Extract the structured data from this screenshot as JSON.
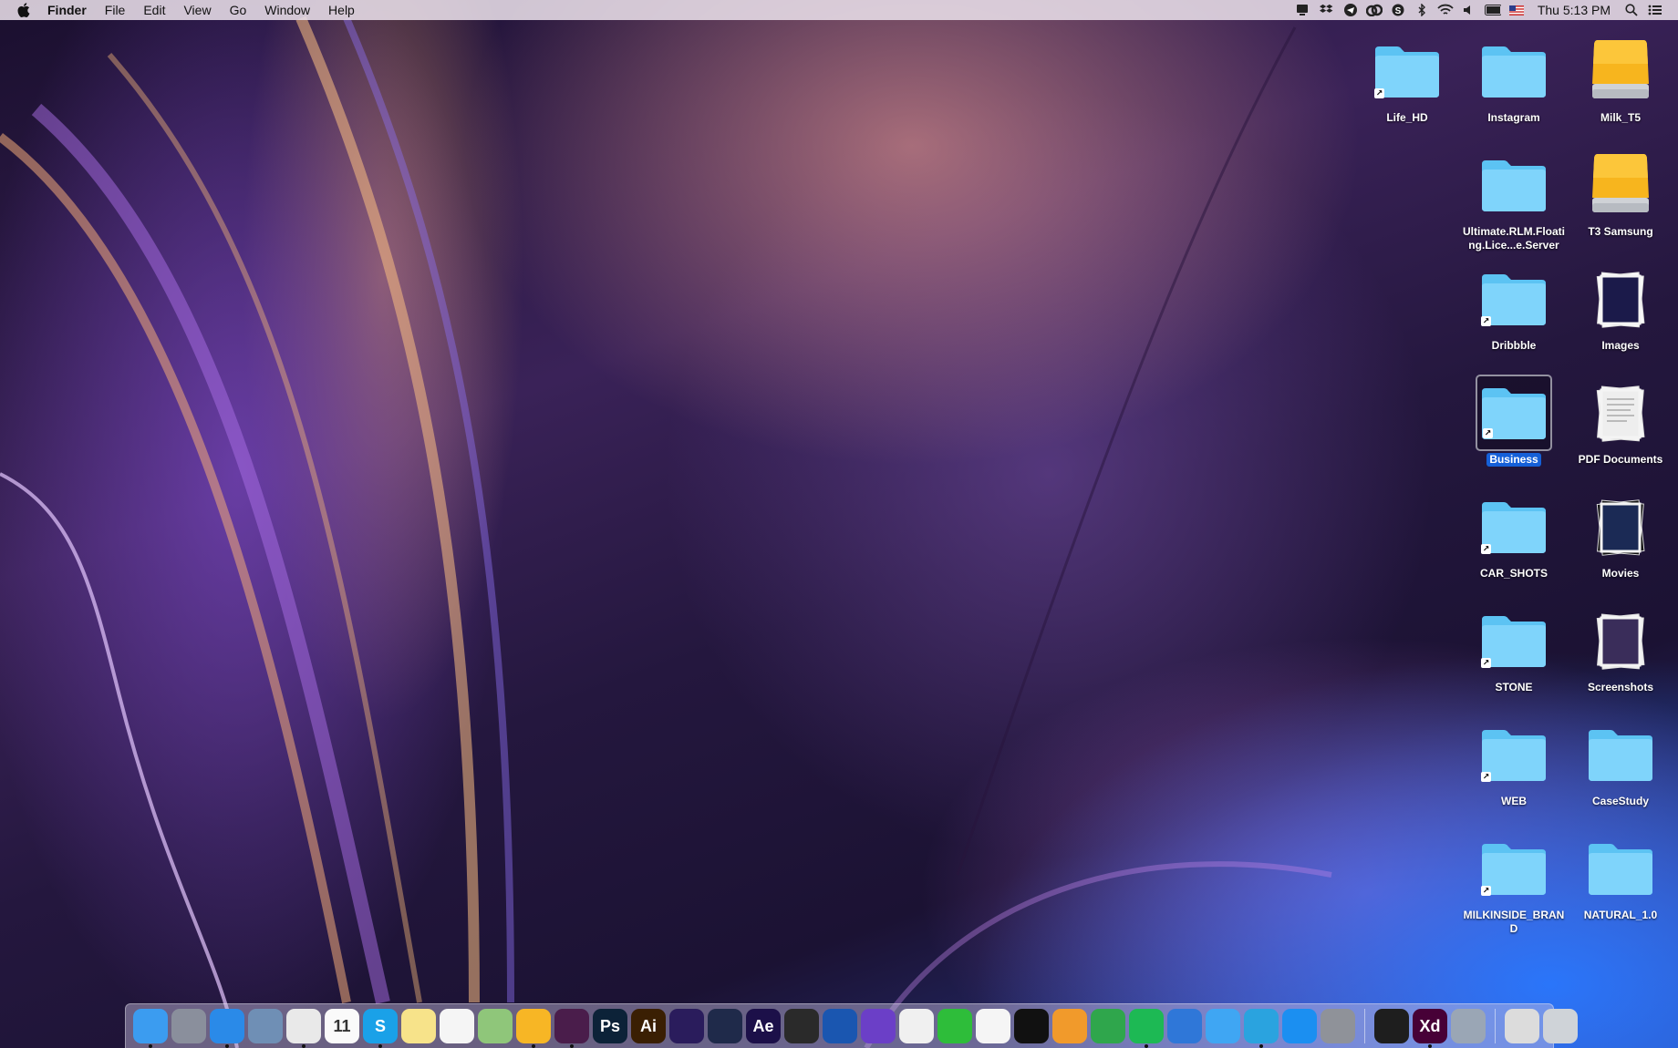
{
  "menubar": {
    "apple_icon": "apple-logo-icon",
    "app_name": "Finder",
    "menus": [
      "File",
      "Edit",
      "View",
      "Go",
      "Window",
      "Help"
    ],
    "status_icons": [
      "notifications-icon",
      "dropbox-icon",
      "telegram-icon",
      "creative-cloud-icon",
      "skype-icon",
      "bluetooth-icon",
      "wifi-icon",
      "volume-icon",
      "battery-icon",
      "us-flag-icon"
    ],
    "clock": "Thu 5:13 PM",
    "right_icons": [
      "spotlight-search-icon",
      "notification-center-icon"
    ]
  },
  "desktop": {
    "items": [
      {
        "label": "Life_HD",
        "kind": "folder",
        "alias": true
      },
      {
        "label": "Instagram",
        "kind": "folder",
        "alias": false
      },
      {
        "label": "Milk_T5",
        "kind": "drive",
        "alias": false
      },
      {
        "label": "Ultimate.RLM.Floating.Lice...e.Server",
        "kind": "folder",
        "alias": false
      },
      {
        "label": "T3 Samsung",
        "kind": "drive",
        "alias": false
      },
      {
        "label": "Dribbble",
        "kind": "folder",
        "alias": true
      },
      {
        "label": "Images",
        "kind": "image-stack",
        "alias": false
      },
      {
        "label": "Business",
        "kind": "folder",
        "alias": true,
        "selected": true
      },
      {
        "label": "PDF Documents",
        "kind": "doc-stack",
        "alias": false
      },
      {
        "label": "CAR_SHOTS",
        "kind": "folder",
        "alias": true
      },
      {
        "label": "Movies",
        "kind": "movie-stack",
        "alias": false
      },
      {
        "label": "STONE",
        "kind": "folder",
        "alias": true
      },
      {
        "label": "Screenshots",
        "kind": "screenshot-stack",
        "alias": false
      },
      {
        "label": "WEB",
        "kind": "folder",
        "alias": true
      },
      {
        "label": "CaseStudy",
        "kind": "folder",
        "alias": false
      },
      {
        "label": "MILKINSIDE_BRAND",
        "kind": "folder",
        "alias": true
      },
      {
        "label": "NATURAL_1.0",
        "kind": "folder",
        "alias": false
      }
    ]
  },
  "dock": {
    "apps": [
      {
        "name": "finder-icon",
        "glyph": "",
        "color": "#3b9cf0",
        "running": true
      },
      {
        "name": "launchpad-icon",
        "glyph": "",
        "color": "#8a8f9c",
        "running": false
      },
      {
        "name": "safari-icon",
        "glyph": "",
        "color": "#2a8ae8",
        "running": true
      },
      {
        "name": "preview-icon",
        "glyph": "",
        "color": "#6f8fb5",
        "running": false
      },
      {
        "name": "chrome-icon",
        "glyph": "",
        "color": "#e9e9e9",
        "running": true
      },
      {
        "name": "calendar-icon",
        "glyph": "11",
        "color": "#fafafa",
        "running": false
      },
      {
        "name": "skype-icon",
        "glyph": "S",
        "color": "#1aa1e8",
        "running": true
      },
      {
        "name": "notes-icon",
        "glyph": "",
        "color": "#f7e38a",
        "running": false
      },
      {
        "name": "reminders-icon",
        "glyph": "",
        "color": "#f5f5f5",
        "running": false
      },
      {
        "name": "maps-icon",
        "glyph": "",
        "color": "#8fc67a",
        "running": false
      },
      {
        "name": "sketch-icon",
        "glyph": "",
        "color": "#f7b625",
        "running": true
      },
      {
        "name": "slack-icon",
        "glyph": "",
        "color": "#4a1d4b",
        "running": true
      },
      {
        "name": "photoshop-icon",
        "glyph": "Ps",
        "color": "#0c2238",
        "running": false
      },
      {
        "name": "illustrator-icon",
        "glyph": "Ai",
        "color": "#3a1f03",
        "running": false
      },
      {
        "name": "media-encoder-icon",
        "glyph": "",
        "color": "#2a1c5c",
        "running": false
      },
      {
        "name": "cinema4d-icon",
        "glyph": "",
        "color": "#1f2a4a",
        "running": false
      },
      {
        "name": "after-effects-icon",
        "glyph": "Ae",
        "color": "#1c1049",
        "running": false
      },
      {
        "name": "final-cut-icon",
        "glyph": "",
        "color": "#2a2a2a",
        "running": false
      },
      {
        "name": "affinity-icon",
        "glyph": "",
        "color": "#1a56b0",
        "running": false
      },
      {
        "name": "imovie-icon",
        "glyph": "",
        "color": "#6b3fc7",
        "running": false
      },
      {
        "name": "photos-icon",
        "glyph": "",
        "color": "#f0f0f0",
        "running": false
      },
      {
        "name": "facetime-icon",
        "glyph": "",
        "color": "#2ebd3a",
        "running": false
      },
      {
        "name": "itunes-icon",
        "glyph": "",
        "color": "#f5f5f5",
        "running": false
      },
      {
        "name": "capture-icon",
        "glyph": "",
        "color": "#111111",
        "running": false
      },
      {
        "name": "pages-icon",
        "glyph": "",
        "color": "#f19a2b",
        "running": false
      },
      {
        "name": "numbers-icon",
        "glyph": "",
        "color": "#2fa64c",
        "running": false
      },
      {
        "name": "spotify-icon",
        "glyph": "",
        "color": "#1db954",
        "running": true
      },
      {
        "name": "keynote-icon",
        "glyph": "",
        "color": "#2f77d8",
        "running": false
      },
      {
        "name": "messages-icon",
        "glyph": "",
        "color": "#3fa6f3",
        "running": false
      },
      {
        "name": "telegram-icon",
        "glyph": "",
        "color": "#2aa3df",
        "running": true
      },
      {
        "name": "app-store-icon",
        "glyph": "",
        "color": "#1b8ff1",
        "running": false
      },
      {
        "name": "system-preferences-icon",
        "glyph": "",
        "color": "#8f9299",
        "running": false
      },
      {
        "name": "figma-icon",
        "glyph": "",
        "color": "#1e1e1e",
        "running": false
      },
      {
        "name": "xd-icon",
        "glyph": "Xd",
        "color": "#470137",
        "running": true
      },
      {
        "name": "image-capture-icon",
        "glyph": "",
        "color": "#9aa6b5",
        "running": false
      },
      {
        "name": "downloads-stack-icon",
        "glyph": "",
        "color": "#dcdcdc",
        "running": false
      },
      {
        "name": "trash-icon",
        "glyph": "",
        "color": "#cfd3d8",
        "running": false
      }
    ]
  }
}
